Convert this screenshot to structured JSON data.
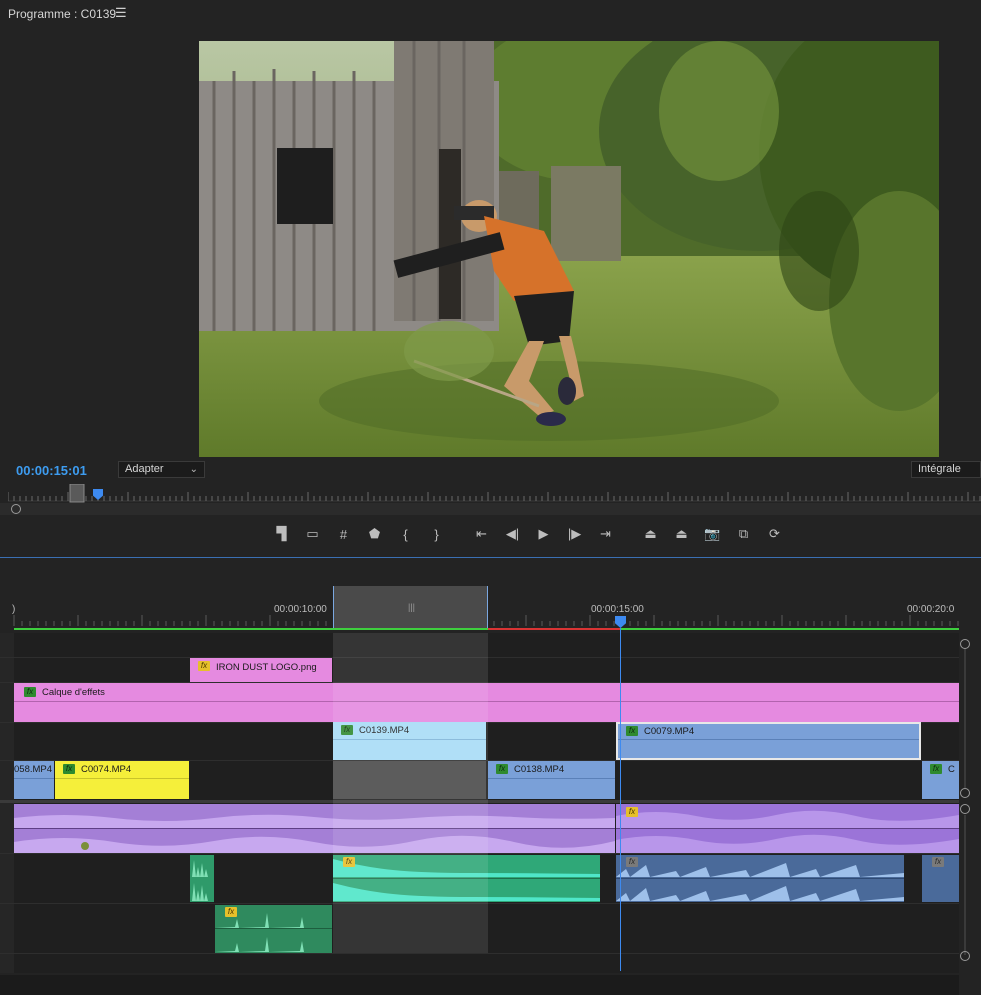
{
  "monitor": {
    "title": "Programme : C0139",
    "menu_icon": "☰",
    "timecode": "00:00:15:01",
    "fit_value": "Adapter",
    "quality_value": "Intégrale"
  },
  "transport": {
    "buttons": [
      {
        "name": "add-marker-button",
        "glyph": "▜"
      },
      {
        "name": "safe-margins-button",
        "glyph": "▭"
      },
      {
        "name": "grid-button",
        "glyph": "#"
      },
      {
        "name": "marker-button",
        "glyph": "⬟"
      },
      {
        "name": "mark-in-button",
        "glyph": "{"
      },
      {
        "name": "mark-out-button",
        "glyph": "}"
      },
      {
        "name": "go-to-in-button",
        "glyph": "⇤"
      },
      {
        "name": "step-back-button",
        "glyph": "◀|"
      },
      {
        "name": "play-button",
        "glyph": "▶"
      },
      {
        "name": "step-forward-button",
        "glyph": "|▶"
      },
      {
        "name": "go-to-out-button",
        "glyph": "⇥"
      },
      {
        "name": "lift-button",
        "glyph": "⏏"
      },
      {
        "name": "extract-button",
        "glyph": "⏏"
      },
      {
        "name": "export-frame-button",
        "glyph": "📷"
      },
      {
        "name": "compare-view-button",
        "glyph": "⧉"
      },
      {
        "name": "toggle-proxies-button",
        "glyph": "⟳"
      }
    ]
  },
  "timeline": {
    "ticks": [
      {
        "label": ")"
      },
      {
        "label": "00:00:10:00"
      },
      {
        "label": "00:00:15:00"
      },
      {
        "label": "00:00:20:0"
      }
    ],
    "clips": {
      "logo": "IRON DUST LOGO.png",
      "effects": "Calque d'effets",
      "c0139": "C0139.MP4",
      "c0079": "C0079.MP4",
      "c058": "058.MP4",
      "c0074": "C0074.MP4",
      "c0138": "C0138.MP4",
      "c_end": "C"
    },
    "fx_label": "fx",
    "grip": "|||"
  },
  "colors": {
    "accent_blue": "#3d8af0",
    "effects_pink": "#e58ae0",
    "clip_lightblue": "#a8dcf7",
    "clip_blue": "#7aa0d8",
    "clip_yellow": "#f5ef3a",
    "audio_purple": "#9b74d8",
    "audio_green": "#3fbf88"
  }
}
